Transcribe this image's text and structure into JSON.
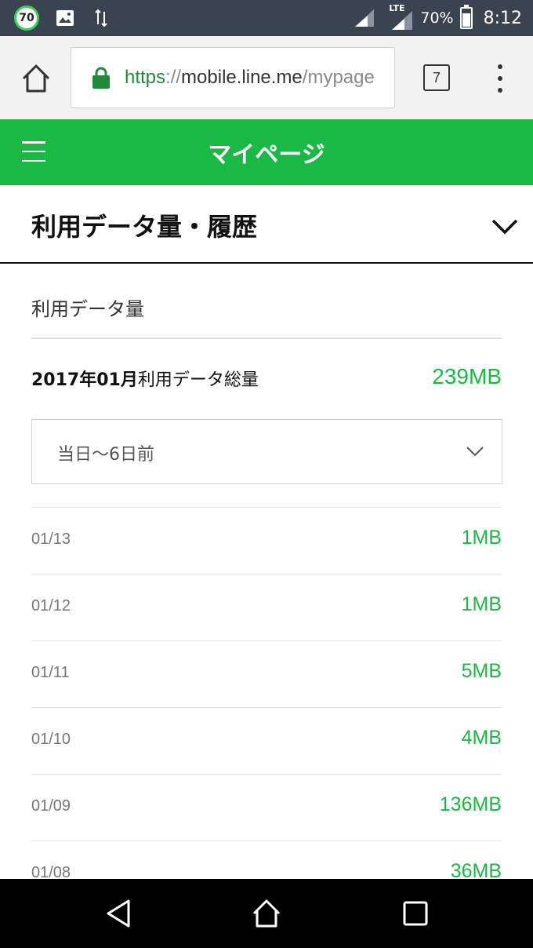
{
  "status_bar": {
    "badge": "70",
    "network": "LTE",
    "battery": "70%",
    "time": "8:12"
  },
  "browser": {
    "url_scheme": "https",
    "url_sep": "://",
    "url_host": "mobile.line.me",
    "url_path": "/mypage",
    "tab_count": "7"
  },
  "header": {
    "title": "マイページ"
  },
  "section": {
    "title": "利用データ量・履歴"
  },
  "usage": {
    "subheading": "利用データ量",
    "total_period": "2017年01月",
    "total_label": "利用データ総量",
    "total_value": "239MB",
    "range_selected": "当日〜6日前",
    "rows": [
      {
        "date": "01/13",
        "value": "1MB"
      },
      {
        "date": "01/12",
        "value": "1MB"
      },
      {
        "date": "01/11",
        "value": "5MB"
      },
      {
        "date": "01/10",
        "value": "4MB"
      },
      {
        "date": "01/09",
        "value": "136MB"
      },
      {
        "date": "01/08",
        "value": "36MB"
      }
    ]
  },
  "colors": {
    "brand_green": "#1ab944",
    "status_bar": "#3a4450"
  }
}
